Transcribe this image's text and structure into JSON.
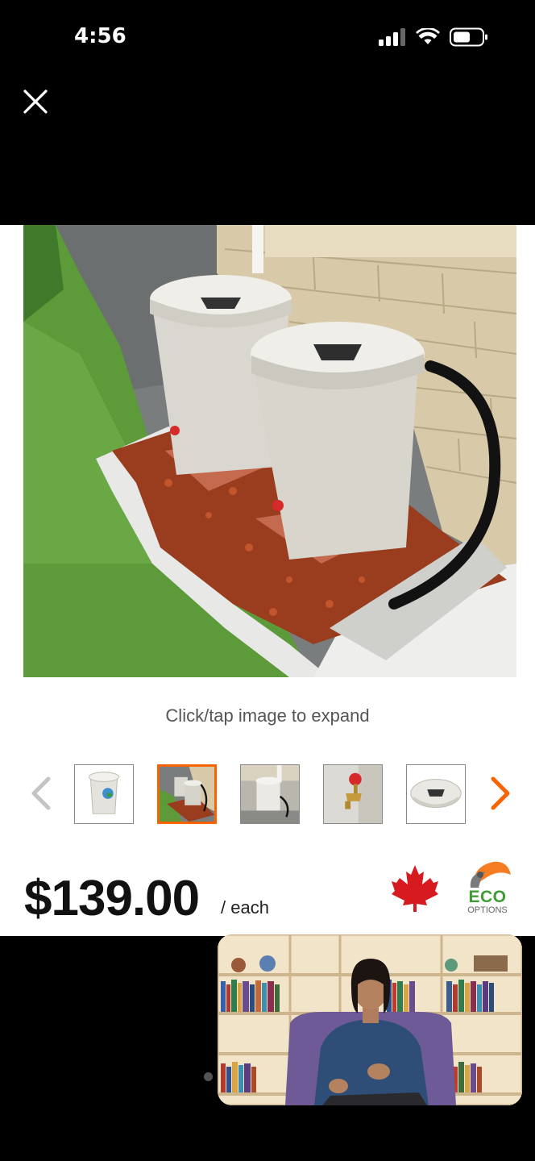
{
  "status_bar": {
    "time": "4:56",
    "icons": [
      "cellular-signal-icon",
      "wifi-icon",
      "battery-icon"
    ]
  },
  "close_icon": "close-icon",
  "product": {
    "image_alt": "Two beige rain barrels beside a stone wall with black hose",
    "expand_hint": "Click/tap image to expand",
    "thumbnails": [
      {
        "name": "thumbnail-barrel-front",
        "selected": false
      },
      {
        "name": "thumbnail-two-barrels",
        "selected": true
      },
      {
        "name": "thumbnail-barrel-installed",
        "selected": false
      },
      {
        "name": "thumbnail-spigot",
        "selected": false
      },
      {
        "name": "thumbnail-lid-top",
        "selected": false
      }
    ],
    "price": "$139.00",
    "price_unit": "/ each",
    "badges": {
      "canada": "maple-leaf-icon",
      "eco_title": "ECO",
      "eco_subtitle": "OPTIONS"
    }
  },
  "colors": {
    "accent_orange": "#f96302",
    "maple_red": "#d71920",
    "eco_green": "#3e9b37"
  }
}
